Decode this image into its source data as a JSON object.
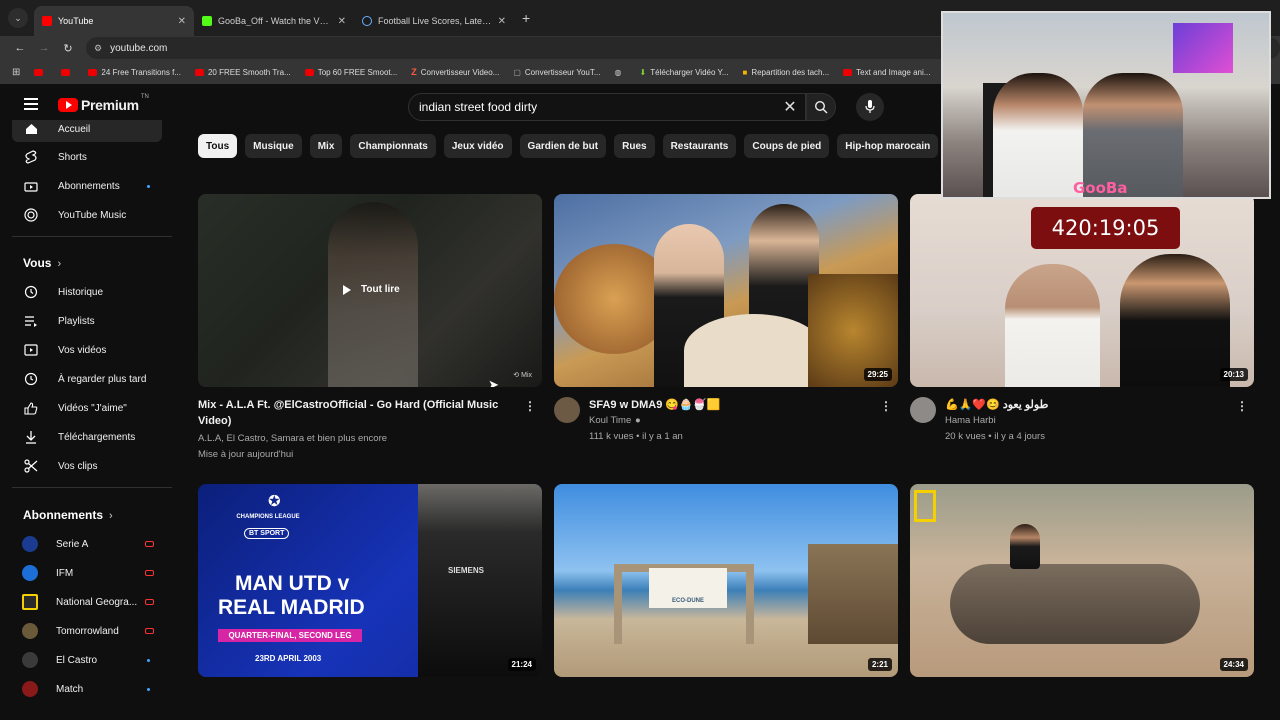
{
  "browser": {
    "tabs": [
      {
        "title": "YouTube",
        "active": true
      },
      {
        "title": "GooBa_Off - Watch the VOD on Kick",
        "active": false
      },
      {
        "title": "Football Live Scores, Latest Football News",
        "active": false
      }
    ],
    "url": "youtube.com",
    "bookmarks": [
      "24 Free Transitions f...",
      "20 FREE Smooth Tra...",
      "Top 60 FREE Smoot...",
      "Convertisseur Video...",
      "Convertisseur YouT...",
      "Télécharger Vidéo Y...",
      "Repartition des tach...",
      "Text and Image ani..."
    ]
  },
  "youtube": {
    "logo_text": "Premium",
    "logo_tn": "TN",
    "search_value": "indian street food dirty",
    "sidebar": {
      "main": [
        {
          "label": "Accueil",
          "icon": "home-icon"
        },
        {
          "label": "Shorts",
          "icon": "shorts-icon"
        },
        {
          "label": "Abonnements",
          "icon": "subscriptions-icon"
        },
        {
          "label": "YouTube Music",
          "icon": "music-icon"
        }
      ],
      "you_heading": "Vous",
      "you": [
        {
          "label": "Historique",
          "icon": "history-icon"
        },
        {
          "label": "Playlists",
          "icon": "playlists-icon"
        },
        {
          "label": "Vos vidéos",
          "icon": "your-videos-icon"
        },
        {
          "label": "À regarder plus tard",
          "icon": "watch-later-icon"
        },
        {
          "label": "Vidéos \"J'aime\"",
          "icon": "liked-icon"
        },
        {
          "label": "Téléchargements",
          "icon": "downloads-icon"
        },
        {
          "label": "Vos clips",
          "icon": "clips-icon"
        }
      ],
      "subs_heading": "Abonnements",
      "subs": [
        {
          "label": "Serie A",
          "color": "#1a3b8f"
        },
        {
          "label": "IFM",
          "color": "#1d6fd8"
        },
        {
          "label": "National Geogra...",
          "color": "#2a2a2a"
        },
        {
          "label": "Tomorrowland",
          "color": "#6b5a3a"
        },
        {
          "label": "El Castro",
          "color": "#3a3a3a"
        },
        {
          "label": "Match",
          "color": "#8a1a1a"
        }
      ]
    },
    "chips": [
      "Tous",
      "Musique",
      "Mix",
      "Championnats",
      "Jeux vidéo",
      "Gardien de but",
      "Rues",
      "Restaurants",
      "Coups de pied",
      "Hip-hop marocain"
    ],
    "videos": [
      {
        "title": "Mix - A.L.A Ft. @ElCastroOfficial - Go Hard (Official Music Video)",
        "channel": "A.L.A, El Castro, Samara et bien plus encore",
        "stats": "Mise à jour aujourd'hui",
        "duration": "",
        "overlay": "Tout lire",
        "mix_label": "Mix"
      },
      {
        "title": "SFA9 w DMA9 😋🧁🍧🟨",
        "channel": "Koul Time",
        "stats": "111 k vues • il y a 1 an",
        "duration": "29:25"
      },
      {
        "title": "💪🙏❤️😊 طولو يعود",
        "channel": "Hama Harbi",
        "stats": "20 k vues • il y a 4 jours",
        "duration": "20:13"
      },
      {
        "title": "",
        "channel": "",
        "stats": "",
        "duration": "21:24",
        "thumb_text": {
          "league": "CHAMPIONS LEAGUE",
          "broadcaster": "BT SPORT",
          "headline1": "MAN UTD v",
          "headline2": "REAL MADRID",
          "stage": "QUARTER-FINAL, SECOND LEG",
          "date": "23RD APRIL 2003",
          "shirt": "SIEMENS"
        }
      },
      {
        "title": "",
        "channel": "",
        "stats": "",
        "duration": "2:21",
        "sign": "ECO-DUNE"
      },
      {
        "title": "",
        "channel": "",
        "stats": "",
        "duration": "24:34"
      }
    ]
  },
  "overlay": {
    "streamer": "GooBa",
    "timer": "420:19:05"
  }
}
